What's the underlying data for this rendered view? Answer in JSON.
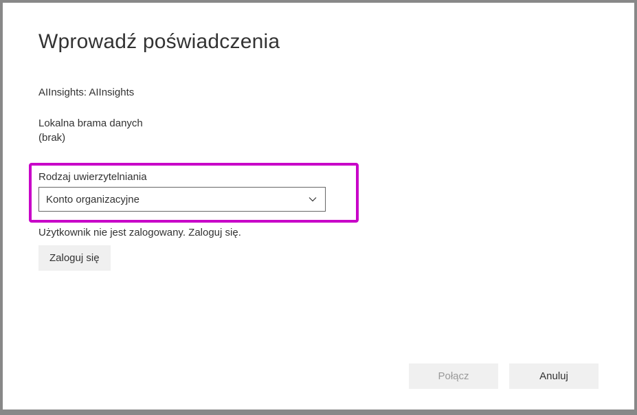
{
  "dialog": {
    "title": "Wprowadź poświadczenia",
    "source_label": "AIInsights: AIInsights",
    "gateway_label": "Lokalna brama danych",
    "gateway_value": "(brak)",
    "auth_type_label": "Rodzaj uwierzytelniania",
    "auth_type_value": "Konto organizacyjne",
    "login_status": "Użytkownik nie jest zalogowany. Zaloguj się.",
    "signin_button": "Zaloguj się",
    "connect_button": "Połącz",
    "cancel_button": "Anuluj"
  },
  "colors": {
    "highlight": "#c800c8"
  }
}
